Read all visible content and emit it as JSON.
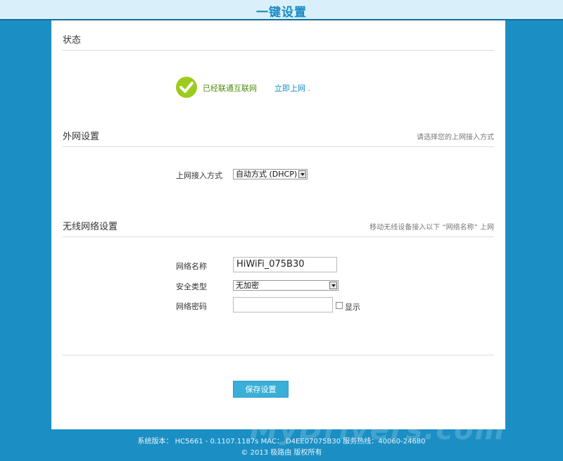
{
  "header": {
    "title": "一键设置"
  },
  "status": {
    "title": "状态",
    "message": "已经联通互联网",
    "link": "立即上网 ."
  },
  "wan": {
    "title": "外网设置",
    "hint": "请选择您的上网接入方式",
    "access_label": "上网接入方式",
    "access_value": "自动方式 (DHCP)"
  },
  "wireless": {
    "title": "无线网络设置",
    "hint": "移动无线设备接入以下 “网络名称” 上网",
    "ssid_label": "网络名称",
    "ssid_value": "HiWiFi_075B30",
    "security_label": "安全类型",
    "security_value": "无加密",
    "password_label": "网络密码",
    "password_value": "",
    "show_label": "显示"
  },
  "actions": {
    "save_label": "保存设置"
  },
  "footer": {
    "line1": "系统版本： HC5661 - 0.1107.1187s    MAC： D4EE07075B30    服务热线：40060-24680",
    "line2": "© 2013 极路由 版权所有"
  },
  "watermark": "MyDrivers.com",
  "colors": {
    "accent": "#1a8cc6",
    "background": "#1b8fc4",
    "success": "#9ccb1e"
  },
  "icons": {
    "status": "check-icon",
    "select_arrow": "chevron-down-icon"
  }
}
